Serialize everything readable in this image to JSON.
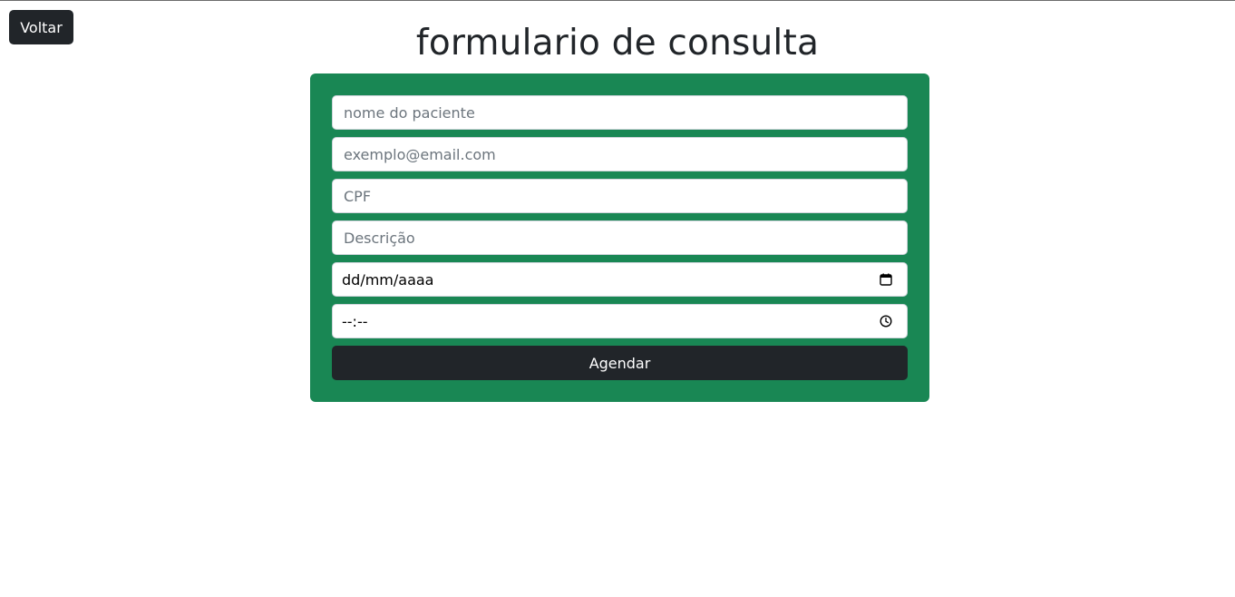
{
  "header": {
    "back_label": "Voltar",
    "title": "formulario de consulta"
  },
  "form": {
    "patient_name": {
      "value": "",
      "placeholder": "nome do paciente"
    },
    "email": {
      "value": "",
      "placeholder": "exemplo@email.com"
    },
    "cpf": {
      "value": "",
      "placeholder": "CPF"
    },
    "description": {
      "value": "",
      "placeholder": "Descrição"
    },
    "date": {
      "display": "dd/mm/aaaa",
      "icon": "calendar-icon"
    },
    "time": {
      "display": "--:--",
      "icon": "clock-icon"
    },
    "submit_label": "Agendar"
  },
  "colors": {
    "card_background": "#198754",
    "dark_button": "#212529",
    "title_text": "#212529",
    "placeholder_text": "#6c757d"
  }
}
